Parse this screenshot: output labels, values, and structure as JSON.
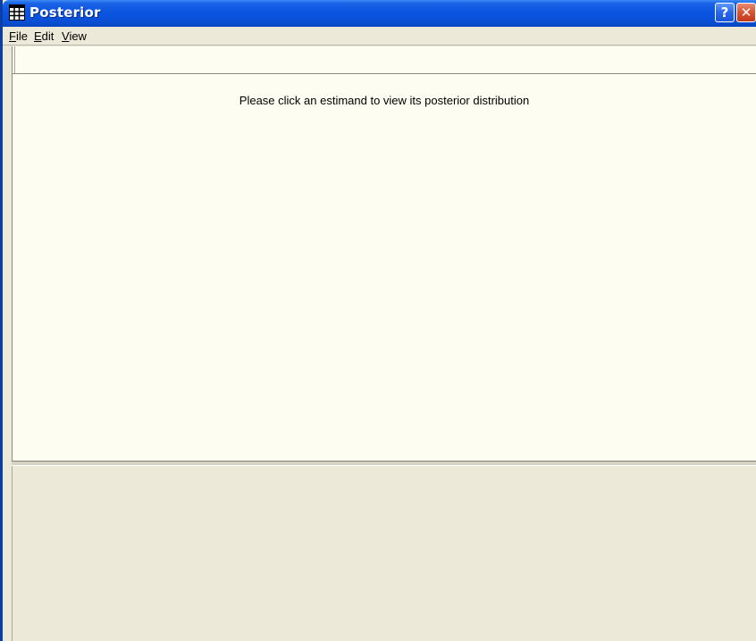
{
  "window": {
    "title": "Posterior",
    "icon": "grid-table-icon",
    "help_button_label": "?",
    "close_button_label": "✕"
  },
  "menubar": {
    "items": [
      {
        "label_accel": "F",
        "label_rest": "ile"
      },
      {
        "label_accel": "E",
        "label_rest": "dit"
      },
      {
        "label_accel": "V",
        "label_rest": "iew"
      }
    ]
  },
  "main": {
    "message": "Please click an estimand to view its posterior distribution"
  },
  "colors": {
    "titlebar": "#0b55e0",
    "content_bg": "#fefdf2",
    "pane_bg": "#ece9d8",
    "close_button": "#d9512f"
  }
}
